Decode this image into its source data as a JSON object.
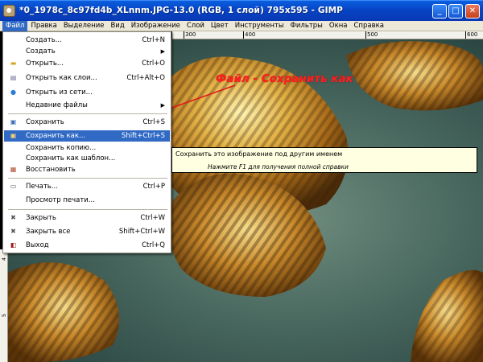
{
  "window": {
    "title": "*0_1978c_8c97fd4b_XLnnm.JPG-13.0 (RGB, 1 слой) 795x595 - GIMP",
    "min_glyph": "_",
    "max_glyph": "□",
    "close_glyph": "✕"
  },
  "menubar": {
    "items": [
      "Файл",
      "Правка",
      "Выделение",
      "Вид",
      "Изображение",
      "Слой",
      "Цвет",
      "Инструменты",
      "Фильтры",
      "Окна",
      "Справка"
    ]
  },
  "ruler": {
    "top_ticks": [
      "300",
      "400",
      "500",
      "600"
    ],
    "left_ticks": [
      "4",
      "5"
    ]
  },
  "file_menu": {
    "items": [
      {
        "icon": "new-icon",
        "glyph": "",
        "label": "Создать...",
        "shortcut": "Ctrl+N"
      },
      {
        "icon": "",
        "glyph": "",
        "label": "Создать",
        "shortcut": "",
        "submenu": "▶"
      },
      {
        "icon": "open-folder-icon",
        "glyph": "▬",
        "label": "Открыть...",
        "shortcut": "Ctrl+O"
      },
      {
        "icon": "open-layers-icon",
        "glyph": "▤",
        "label": "Открыть как слои...",
        "shortcut": "Ctrl+Alt+O"
      },
      {
        "icon": "globe-icon",
        "glyph": "●",
        "label": "Открыть из сети...",
        "shortcut": ""
      },
      {
        "icon": "",
        "glyph": "",
        "label": "Недавние файлы",
        "shortcut": "",
        "submenu": "▶"
      },
      {
        "icon": "save-icon",
        "glyph": "▣",
        "label": "Сохранить",
        "shortcut": "Ctrl+S"
      },
      {
        "icon": "save-as-icon",
        "glyph": "▣",
        "label": "Сохранить как...",
        "shortcut": "Shift+Ctrl+S"
      },
      {
        "icon": "",
        "glyph": "",
        "label": "Сохранить копию...",
        "shortcut": ""
      },
      {
        "icon": "",
        "glyph": "",
        "label": "Сохранить как шаблон...",
        "shortcut": ""
      },
      {
        "icon": "revert-icon",
        "glyph": "▦",
        "label": "Восстановить",
        "shortcut": ""
      },
      {
        "icon": "print-icon",
        "glyph": "▭",
        "label": "Печать...",
        "shortcut": "Ctrl+P"
      },
      {
        "icon": "",
        "glyph": "",
        "label": "Просмотр печати...",
        "shortcut": ""
      },
      {
        "icon": "close-icon",
        "glyph": "✖",
        "label": "Закрыть",
        "shortcut": "Ctrl+W"
      },
      {
        "icon": "close-all-icon",
        "glyph": "✖",
        "label": "Закрыть все",
        "shortcut": "Shift+Ctrl+W"
      },
      {
        "icon": "quit-icon",
        "glyph": "◧",
        "label": "Выход",
        "shortcut": "Ctrl+Q"
      }
    ]
  },
  "tooltip": {
    "line1": "Сохранить это изображение под другим именем",
    "line2": "Нажмите F1 для получения полной справки"
  },
  "annotation": {
    "text": "Файл - Сохранить как",
    "color": "#ff2020"
  },
  "colors": {
    "titlebar": "#0744c5",
    "menu_highlight": "#316ac5",
    "menubar_bg": "#ece9d8",
    "tooltip_bg": "#ffffe1"
  }
}
